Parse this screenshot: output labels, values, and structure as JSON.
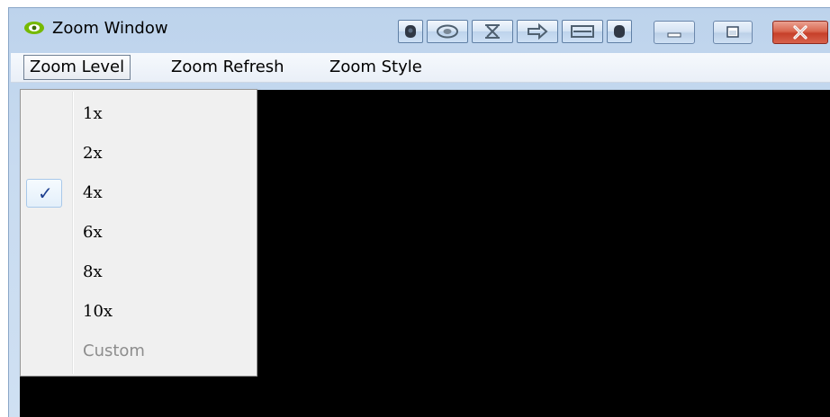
{
  "window": {
    "title": "Zoom Window",
    "icons": {
      "app": "nvidia-eye-icon",
      "toolbar": [
        "camera-dark-icon",
        "nvidia-eye-icon",
        "hourglass-icon",
        "arrow-right-icon",
        "window-frame-icon",
        "dot-dark-icon"
      ],
      "controls": [
        "minimize-icon",
        "maximize-icon",
        "close-icon"
      ]
    },
    "colors": {
      "close_red": "#c6402a",
      "content_bg": "#000000"
    }
  },
  "menubar": {
    "items": [
      "Zoom Level",
      "Zoom Refresh",
      "Zoom Style"
    ]
  },
  "zoom_menu": {
    "items": [
      {
        "label": "1x",
        "checked": false,
        "enabled": true
      },
      {
        "label": "2x",
        "checked": false,
        "enabled": true
      },
      {
        "label": "4x",
        "checked": true,
        "enabled": true
      },
      {
        "label": "6x",
        "checked": false,
        "enabled": true
      },
      {
        "label": "8x",
        "checked": false,
        "enabled": true
      },
      {
        "label": "10x",
        "checked": false,
        "enabled": true
      },
      {
        "label": "Custom",
        "checked": false,
        "enabled": false
      }
    ],
    "check_glyph": "✓"
  }
}
